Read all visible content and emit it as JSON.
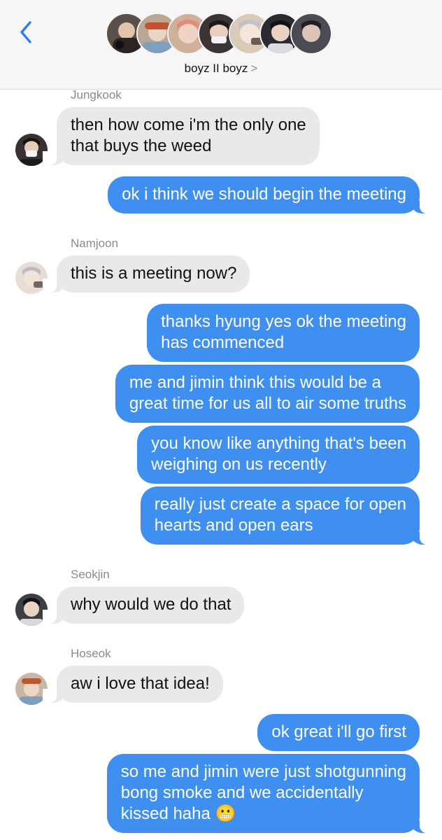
{
  "header": {
    "group_name": "boyz II boyz",
    "chevron": ">",
    "avatars": [
      {
        "icon": "member-avatar-1",
        "bg": "#3a3230",
        "fg": "#d9b8a0"
      },
      {
        "icon": "member-avatar-2",
        "bg": "#b8a08a",
        "fg": "#e9d7c8"
      },
      {
        "icon": "member-avatar-3",
        "bg": "#c8a48d",
        "fg": "#f3d5c4"
      },
      {
        "icon": "member-avatar-4",
        "bg": "#2d2a2a",
        "fg": "#e6cdbd"
      },
      {
        "icon": "member-avatar-5",
        "bg": "#d9c6b3",
        "fg": "#f2e4d8"
      },
      {
        "icon": "member-avatar-6",
        "bg": "#2b2b30",
        "fg": "#e8d0c0"
      },
      {
        "icon": "member-avatar-7",
        "bg": "#404048",
        "fg": "#d8c2b4"
      }
    ]
  },
  "colors": {
    "sent_bubble": "#3e8ff0",
    "received_bubble": "#e9e9eb",
    "accent": "#2f7cf6"
  },
  "messages": [
    {
      "sender": "Jungkook",
      "lines": [
        "then how come i'm the only one",
        "that buys the weed"
      ]
    },
    {
      "lines": [
        "ok i think we should begin the meeting"
      ]
    },
    {
      "sender": "Namjoon",
      "lines": [
        "this is a meeting now?"
      ]
    },
    {
      "lines": [
        "thanks hyung yes ok the meeting",
        "has commenced"
      ]
    },
    {
      "lines": [
        "me and jimin think this would be a",
        "great time for us all to air some truths"
      ]
    },
    {
      "lines": [
        "you know like anything that's been",
        "weighing on us recently"
      ]
    },
    {
      "lines": [
        "really just create a space for open",
        "hearts and open ears"
      ]
    },
    {
      "sender": "Seokjin",
      "lines": [
        "why would we do that"
      ]
    },
    {
      "sender": "Hoseok",
      "lines": [
        "aw i love that idea!"
      ]
    },
    {
      "lines": [
        "ok great i'll go first"
      ]
    },
    {
      "lines": [
        "so me and jimin were just shotgunning",
        "bong smoke and we accidentally",
        "kissed haha"
      ],
      "emoji": "😬"
    }
  ]
}
